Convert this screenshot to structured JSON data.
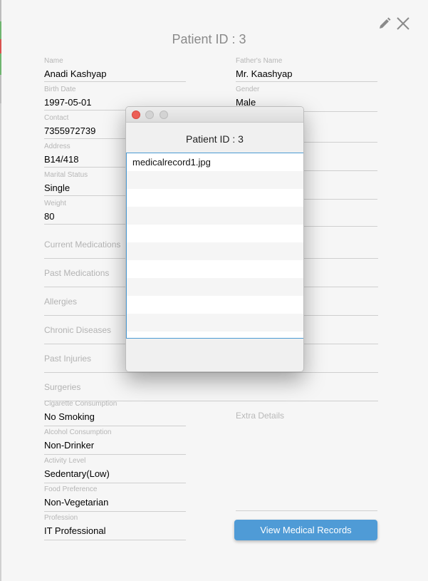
{
  "page_title": "Patient ID : 3",
  "left_fields": [
    {
      "label": "Name",
      "value": "Anadi Kashyap"
    },
    {
      "label": "Birth Date",
      "value": "1997-05-01"
    },
    {
      "label": "Contact",
      "value": "7355972739"
    },
    {
      "label": "Address",
      "value": "B14/418"
    },
    {
      "label": "Marital Status",
      "value": "Single"
    },
    {
      "label": "Weight",
      "value": "80"
    }
  ],
  "left_empty_fields": [
    "Current Medications",
    "Past Medications",
    "Allergies",
    "Chronic Diseases",
    "Past Injuries",
    "Surgeries"
  ],
  "lifestyle_fields": [
    {
      "label": "Cigarette Consumption",
      "value": "No Smoking"
    },
    {
      "label": "Alcohol Consumption",
      "value": "Non-Drinker"
    },
    {
      "label": "Activity Level",
      "value": "Sedentary(Low)"
    },
    {
      "label": "Food Preference",
      "value": "Non-Vegetarian"
    },
    {
      "label": "Profession",
      "value": "IT Professional"
    }
  ],
  "right_fields": [
    {
      "label": "Father's Name",
      "value": "Mr. Kaashyap"
    },
    {
      "label": "Gender",
      "value": "Male"
    }
  ],
  "extra_details_placeholder": "Extra Details",
  "view_button_label": "View Medical Records",
  "modal": {
    "title": "Patient ID : 3",
    "records": [
      "medicalrecord1.jpg",
      "",
      "",
      "",
      "",
      "",
      "",
      "",
      "",
      ""
    ]
  },
  "colors": {
    "accent": "#4f9bd6",
    "close_traffic_light": "#ec5f56",
    "list_border": "#4a9ad3"
  },
  "icons": {
    "edit": "pencil-icon",
    "close": "close-icon"
  }
}
